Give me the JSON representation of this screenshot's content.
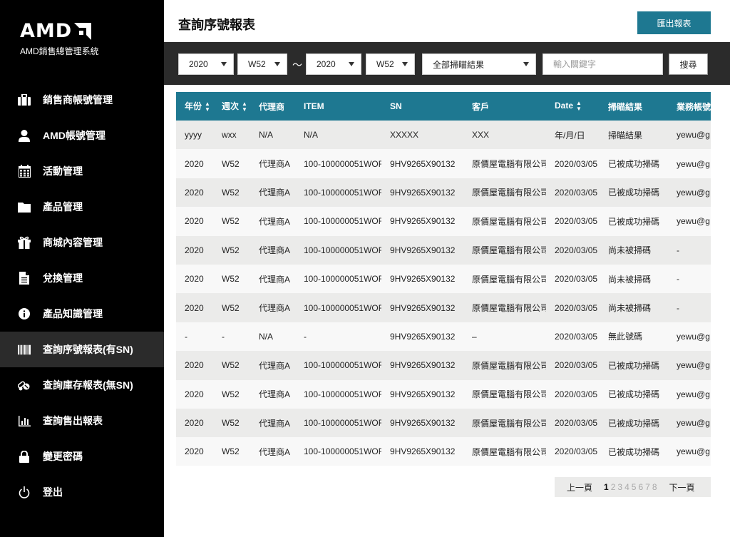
{
  "brand": {
    "logo_text": "AMD",
    "subtitle": "AMD銷售總管理系統"
  },
  "sidebar": {
    "items": [
      {
        "label": "銷售商帳號管理",
        "icon": "briefcase-icon"
      },
      {
        "label": "AMD帳號管理",
        "icon": "user-icon"
      },
      {
        "label": "活動管理",
        "icon": "calendar-icon"
      },
      {
        "label": "產品管理",
        "icon": "folder-icon"
      },
      {
        "label": "商城內容管理",
        "icon": "gift-icon"
      },
      {
        "label": "兌換管理",
        "icon": "document-icon"
      },
      {
        "label": "產品知識管理",
        "icon": "info-icon"
      },
      {
        "label": "查詢序號報表(有SN)",
        "icon": "barcode-icon",
        "active": true
      },
      {
        "label": "查詢庫存報表(無SN)",
        "icon": "pills-icon"
      },
      {
        "label": "查詢售出報表",
        "icon": "bar-chart-icon"
      },
      {
        "label": "變更密碼",
        "icon": "lock-icon"
      },
      {
        "label": "登出",
        "icon": "power-icon"
      }
    ]
  },
  "header": {
    "title": "查詢序號報表",
    "export_label": "匯出報表"
  },
  "filters": {
    "year_from": "2020",
    "week_from": "W52",
    "separator": "～",
    "year_to": "2020",
    "week_to": "W52",
    "result": "全部掃瞄結果",
    "keyword_placeholder": "輸入關鍵字",
    "search_label": "搜尋"
  },
  "table": {
    "columns": [
      "年份",
      "週次",
      "代理商",
      "ITEM",
      "SN",
      "客戶",
      "Date",
      "掃瞄結果",
      "業務帳號"
    ],
    "rows": [
      [
        "yyyy",
        "wxx",
        "N/A",
        "N/A",
        "XXXXX",
        "XXX",
        "年/月/日",
        "掃瞄結果",
        "yewu@g"
      ],
      [
        "2020",
        "W52",
        "代理商A",
        "100-100000051WOF",
        "9HV9265X90132",
        "原價屋電腦有限公司",
        "2020/03/05",
        "已被成功掃碼",
        "yewu@g"
      ],
      [
        "2020",
        "W52",
        "代理商A",
        "100-100000051WOF",
        "9HV9265X90132",
        "原價屋電腦有限公司",
        "2020/03/05",
        "已被成功掃碼",
        "yewu@g"
      ],
      [
        "2020",
        "W52",
        "代理商A",
        "100-100000051WOF",
        "9HV9265X90132",
        "原價屋電腦有限公司",
        "2020/03/05",
        "已被成功掃碼",
        "yewu@g"
      ],
      [
        "2020",
        "W52",
        "代理商A",
        "100-100000051WOF",
        "9HV9265X90132",
        "原價屋電腦有限公司",
        "2020/03/05",
        "尚未被掃碼",
        "-"
      ],
      [
        "2020",
        "W52",
        "代理商A",
        "100-100000051WOF",
        "9HV9265X90132",
        "原價屋電腦有限公司",
        "2020/03/05",
        "尚未被掃碼",
        "-"
      ],
      [
        "2020",
        "W52",
        "代理商A",
        "100-100000051WOF",
        "9HV9265X90132",
        "原價屋電腦有限公司",
        "2020/03/05",
        "尚未被掃碼",
        "-"
      ],
      [
        "-",
        "-",
        "N/A",
        "-",
        "9HV9265X90132",
        "–",
        "2020/03/05",
        "無此號碼",
        "yewu@g"
      ],
      [
        "2020",
        "W52",
        "代理商A",
        "100-100000051WOF",
        "9HV9265X90132",
        "原價屋電腦有限公司",
        "2020/03/05",
        "已被成功掃碼",
        "yewu@g"
      ],
      [
        "2020",
        "W52",
        "代理商A",
        "100-100000051WOF",
        "9HV9265X90132",
        "原價屋電腦有限公司",
        "2020/03/05",
        "已被成功掃碼",
        "yewu@g"
      ],
      [
        "2020",
        "W52",
        "代理商A",
        "100-100000051WOF",
        "9HV9265X90132",
        "原價屋電腦有限公司",
        "2020/03/05",
        "已被成功掃碼",
        "yewu@g"
      ],
      [
        "2020",
        "W52",
        "代理商A",
        "100-100000051WOF",
        "9HV9265X90132",
        "原價屋電腦有限公司",
        "2020/03/05",
        "已被成功掃碼",
        "yewu@g"
      ]
    ]
  },
  "pagination": {
    "prev_label": "上一頁",
    "pages": [
      "1",
      "2",
      "3",
      "4",
      "5",
      "6",
      "7",
      "8"
    ],
    "current": "1",
    "next_label": "下一頁"
  },
  "colors": {
    "accent": "#1e7891",
    "sidebar_bg": "#000000",
    "filter_bar_bg": "#2b2b2b"
  }
}
